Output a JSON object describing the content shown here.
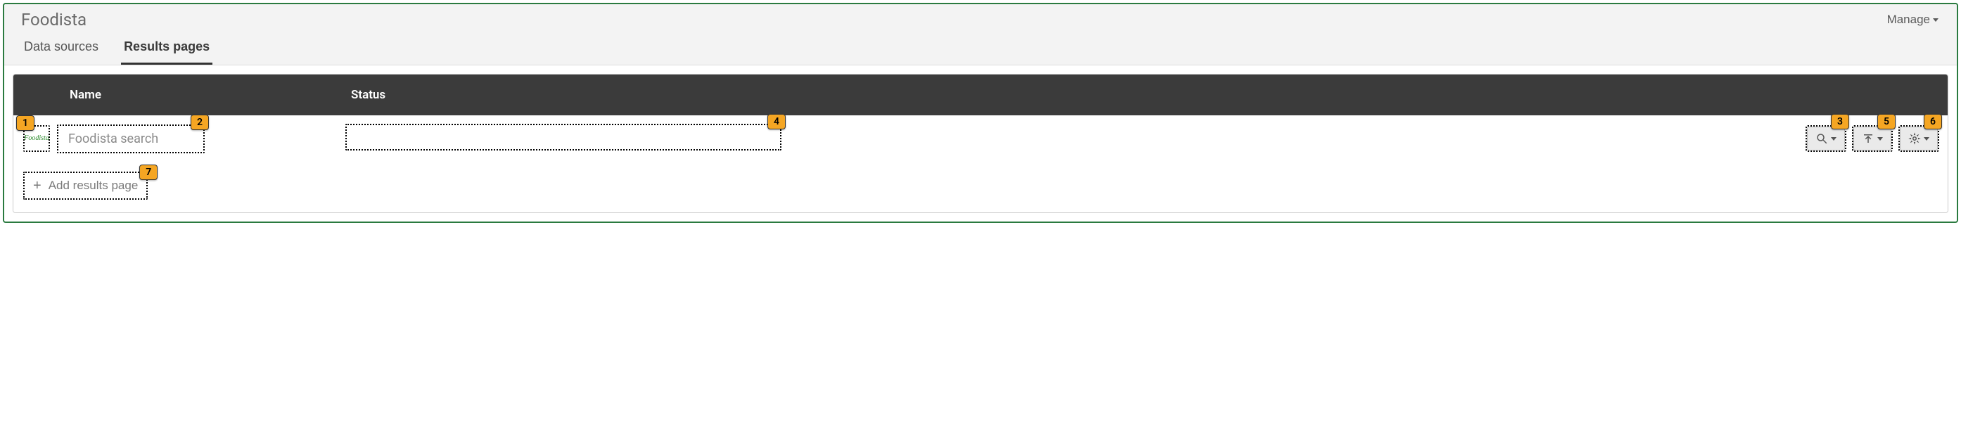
{
  "header": {
    "title": "Foodista",
    "manage_label": "Manage"
  },
  "tabs": [
    {
      "label": "Data sources",
      "active": false
    },
    {
      "label": "Results pages",
      "active": true
    }
  ],
  "table": {
    "columns": {
      "name": "Name",
      "status": "Status"
    },
    "rows": [
      {
        "thumb_text": "Foodista",
        "name": "Foodista search",
        "status": ""
      }
    ]
  },
  "actions": {
    "search_icon": "search-icon",
    "upload_icon": "upload-icon",
    "gear_icon": "gear-icon"
  },
  "add_button_label": "Add results page",
  "annotations": [
    "1",
    "2",
    "3",
    "4",
    "5",
    "6",
    "7"
  ]
}
